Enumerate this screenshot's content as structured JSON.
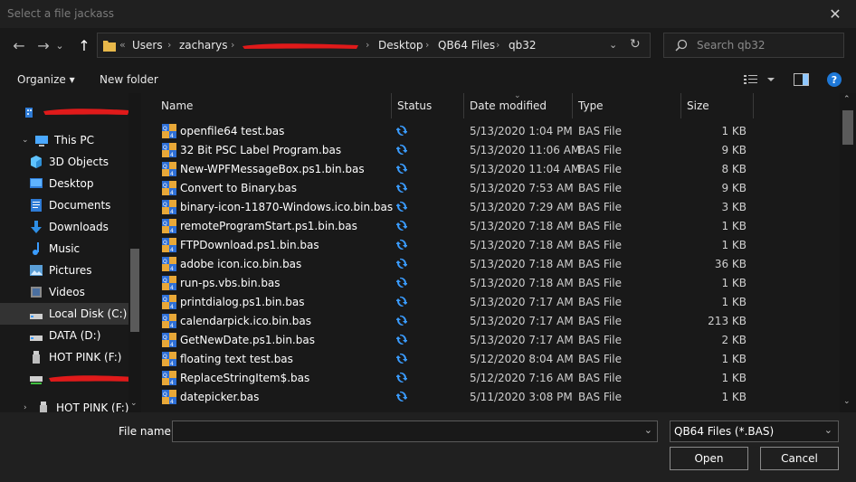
{
  "window": {
    "title": "Select a file jackass",
    "close_glyph": "✕"
  },
  "nav": {
    "back_glyph": "←",
    "forward_glyph": "→",
    "recent_glyph": "⌄",
    "up_glyph": "↑"
  },
  "address": {
    "overflow": "«",
    "crumbs": [
      "Users",
      "zacharys",
      "",
      "Desktop",
      "QB64 Files",
      "qb32"
    ],
    "separator": "›",
    "refresh_glyph": "↻"
  },
  "search": {
    "placeholder": "Search qb32",
    "icon": "search-icon"
  },
  "toolbar": {
    "organize": "Organize ▾",
    "new_folder": "New folder",
    "help": "?"
  },
  "sidebar": {
    "items": [
      {
        "label": "",
        "icon": "network-icon"
      },
      {
        "label": "This PC",
        "icon": "computer-icon"
      },
      {
        "label": "3D Objects",
        "icon": "cube-icon"
      },
      {
        "label": "Desktop",
        "icon": "desktop-icon"
      },
      {
        "label": "Documents",
        "icon": "document-icon"
      },
      {
        "label": "Downloads",
        "icon": "download-icon"
      },
      {
        "label": "Music",
        "icon": "music-icon"
      },
      {
        "label": "Pictures",
        "icon": "pictures-icon"
      },
      {
        "label": "Videos",
        "icon": "video-icon"
      },
      {
        "label": "Local Disk (C:)",
        "icon": "drive-icon"
      },
      {
        "label": "DATA (D:)",
        "icon": "drive-icon"
      },
      {
        "label": "HOT PINK (F:)",
        "icon": "usb-icon"
      },
      {
        "label": "",
        "icon": "network-drive-icon"
      },
      {
        "label": "HOT PINK (F:)",
        "icon": "usb-icon"
      }
    ]
  },
  "columns": [
    "Name",
    "Status",
    "Date modified",
    "Type",
    "Size"
  ],
  "files": [
    {
      "name": "openfile64 test.bas",
      "date": "5/13/2020 1:04 PM",
      "type": "BAS File",
      "size": "1 KB"
    },
    {
      "name": "32 Bit PSC Label Program.bas",
      "date": "5/13/2020 11:06 AM",
      "type": "BAS File",
      "size": "9 KB"
    },
    {
      "name": "New-WPFMessageBox.ps1.bin.bas",
      "date": "5/13/2020 11:04 AM",
      "type": "BAS File",
      "size": "8 KB"
    },
    {
      "name": "Convert to Binary.bas",
      "date": "5/13/2020 7:53 AM",
      "type": "BAS File",
      "size": "9 KB"
    },
    {
      "name": "binary-icon-11870-Windows.ico.bin.bas",
      "date": "5/13/2020 7:29 AM",
      "type": "BAS File",
      "size": "3 KB"
    },
    {
      "name": "remoteProgramStart.ps1.bin.bas",
      "date": "5/13/2020 7:18 AM",
      "type": "BAS File",
      "size": "1 KB"
    },
    {
      "name": "FTPDownload.ps1.bin.bas",
      "date": "5/13/2020 7:18 AM",
      "type": "BAS File",
      "size": "1 KB"
    },
    {
      "name": "adobe icon.ico.bin.bas",
      "date": "5/13/2020 7:18 AM",
      "type": "BAS File",
      "size": "36 KB"
    },
    {
      "name": "run-ps.vbs.bin.bas",
      "date": "5/13/2020 7:18 AM",
      "type": "BAS File",
      "size": "1 KB"
    },
    {
      "name": "printdialog.ps1.bin.bas",
      "date": "5/13/2020 7:17 AM",
      "type": "BAS File",
      "size": "1 KB"
    },
    {
      "name": "calendarpick.ico.bin.bas",
      "date": "5/13/2020 7:17 AM",
      "type": "BAS File",
      "size": "213 KB"
    },
    {
      "name": "GetNewDate.ps1.bin.bas",
      "date": "5/13/2020 7:17 AM",
      "type": "BAS File",
      "size": "2 KB"
    },
    {
      "name": "floating text test.bas",
      "date": "5/12/2020 8:04 AM",
      "type": "BAS File",
      "size": "1 KB"
    },
    {
      "name": "ReplaceStringItem$.bas",
      "date": "5/12/2020 7:16 AM",
      "type": "BAS File",
      "size": "1 KB"
    },
    {
      "name": "datepicker.bas",
      "date": "5/11/2020 3:08 PM",
      "type": "BAS File",
      "size": "1 KB"
    }
  ],
  "bottom": {
    "filename_label": "File name:",
    "filename_value": "",
    "filter": "QB64 Files (*.BAS)",
    "open": "Open",
    "cancel": "Cancel"
  },
  "colors": {
    "accent": "#1e90ff",
    "redaction": "#e01a1a",
    "background": "#191919"
  }
}
